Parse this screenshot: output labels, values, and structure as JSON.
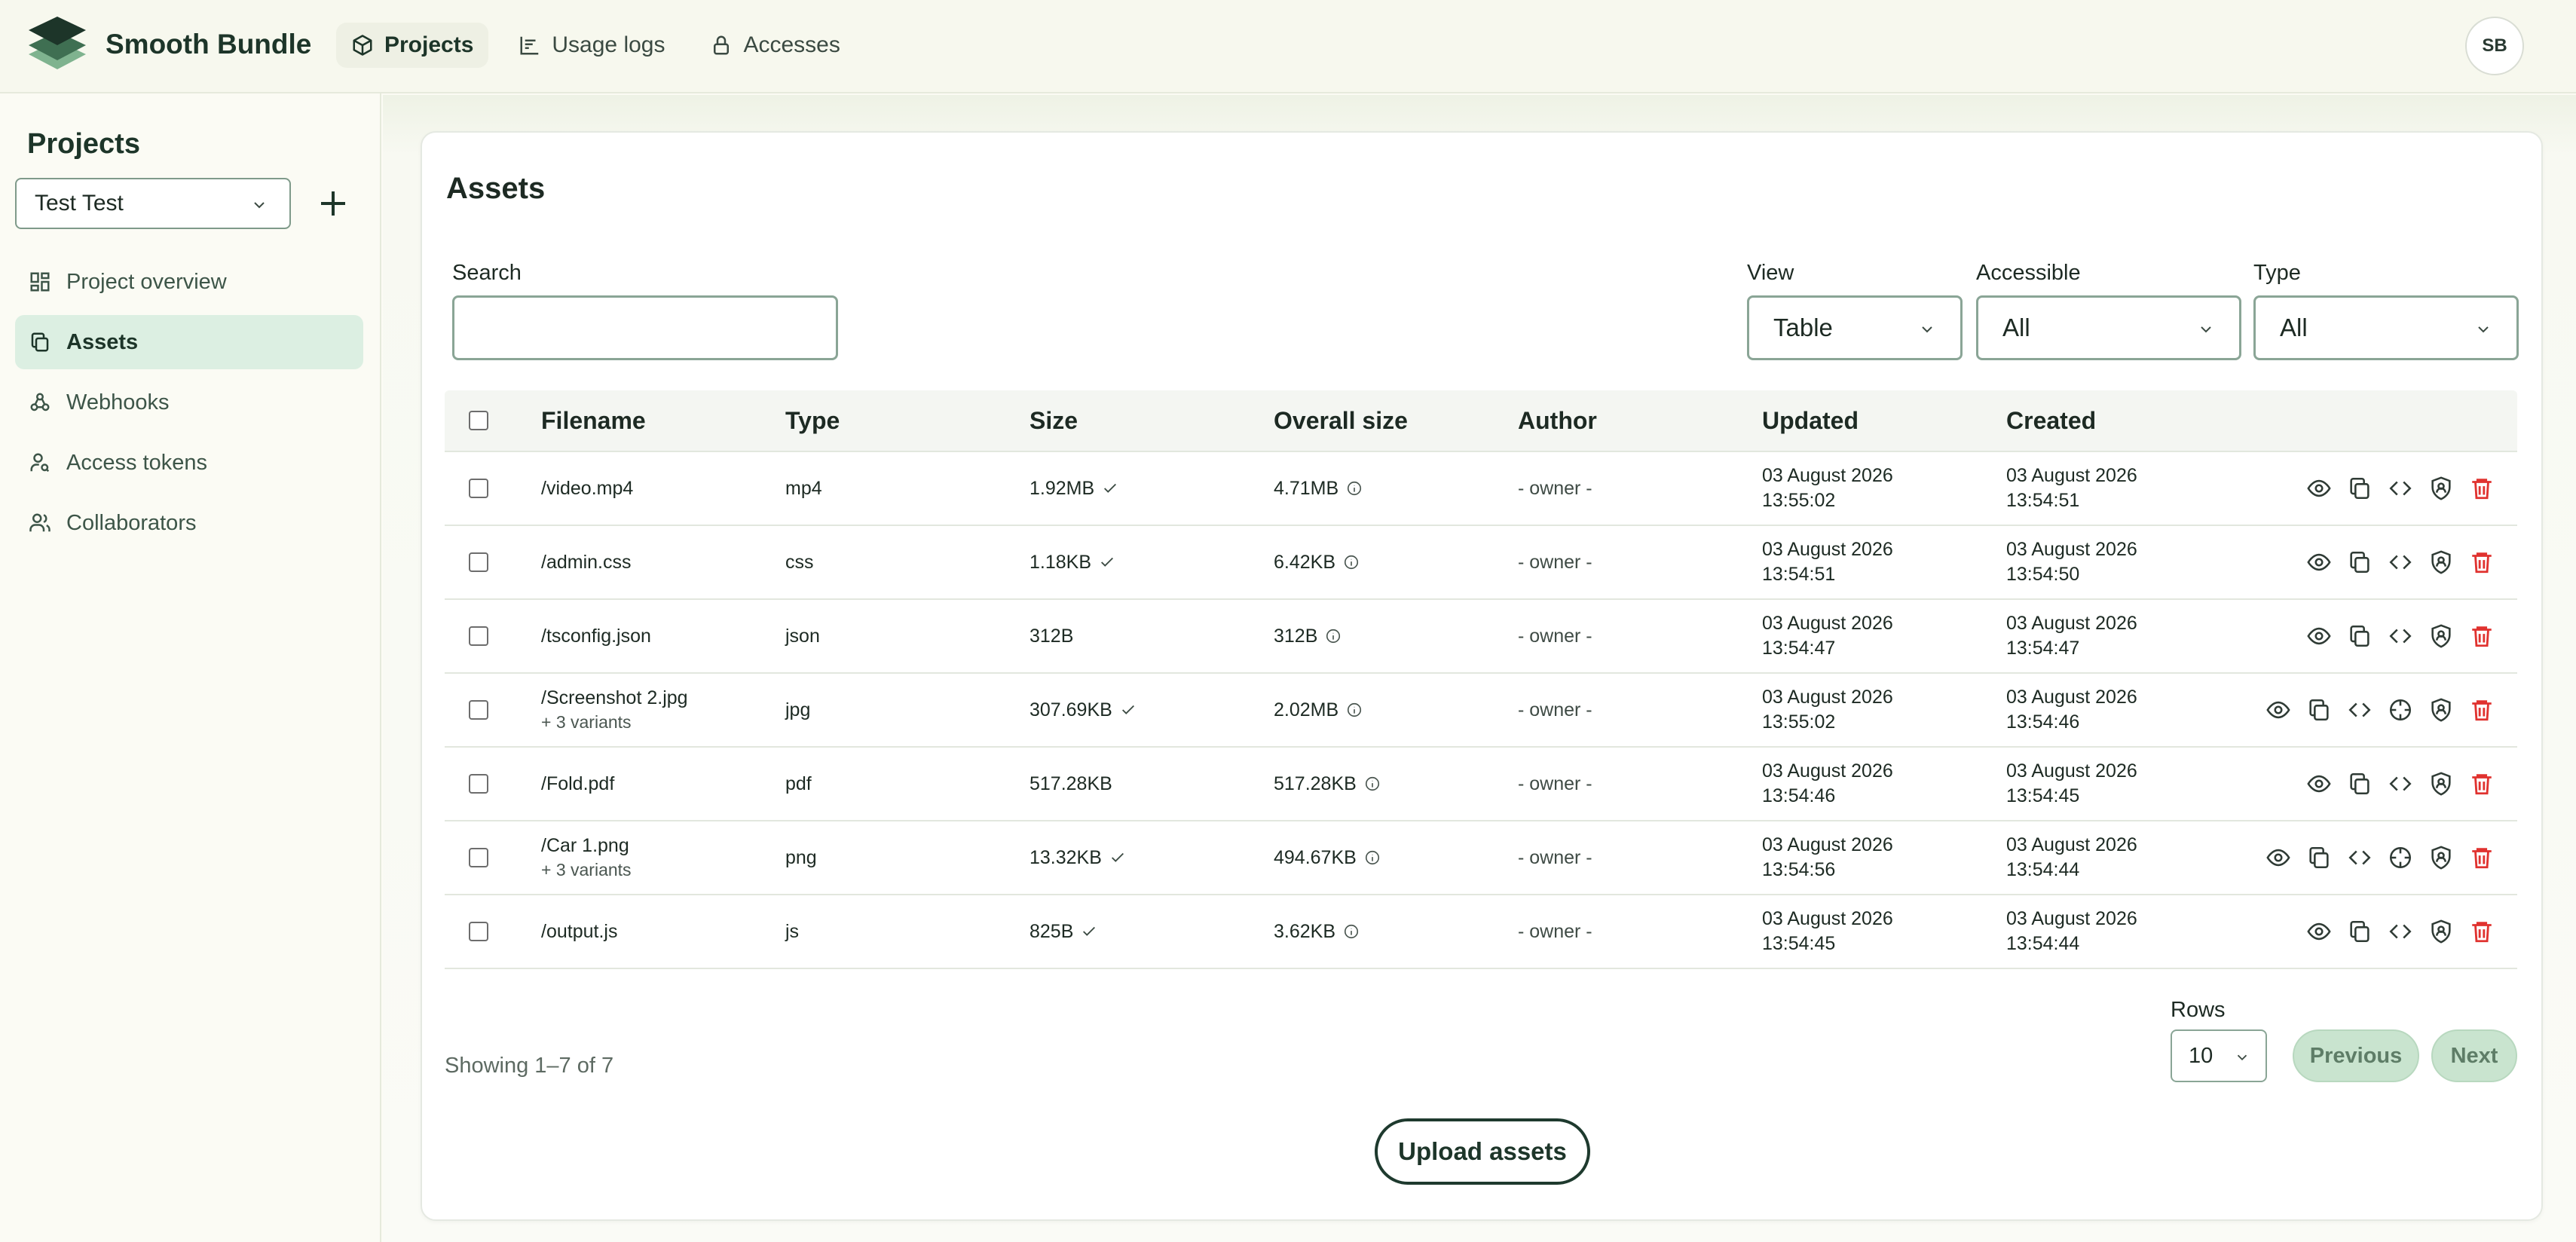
{
  "app": {
    "brand": "Smooth Bundle",
    "avatar_initials": "SB"
  },
  "nav": [
    {
      "label": "Projects",
      "icon": "box-icon",
      "active": true
    },
    {
      "label": "Usage logs",
      "icon": "chart-icon",
      "active": false
    },
    {
      "label": "Accesses",
      "icon": "lock-icon",
      "active": false
    }
  ],
  "sidebar": {
    "title": "Projects",
    "project_selected": "Test Test",
    "items": [
      {
        "label": "Project overview",
        "icon": "grid-icon"
      },
      {
        "label": "Assets",
        "icon": "copy-icon",
        "active": true
      },
      {
        "label": "Webhooks",
        "icon": "webhook-icon"
      },
      {
        "label": "Access tokens",
        "icon": "user-key-icon"
      },
      {
        "label": "Collaborators",
        "icon": "users-icon"
      }
    ]
  },
  "assets": {
    "title": "Assets",
    "filters": {
      "search_label": "Search",
      "search_value": "",
      "view_label": "View",
      "view_value": "Table",
      "accessible_label": "Accessible",
      "accessible_value": "All",
      "type_label": "Type",
      "type_value": "All"
    },
    "columns": [
      "Filename",
      "Type",
      "Size",
      "Overall size",
      "Author",
      "Updated",
      "Created"
    ],
    "rows": [
      {
        "filename": "/video.mp4",
        "variants": "",
        "type": "mp4",
        "size": "1.92MB",
        "size_check": true,
        "overall": "4.71MB",
        "author": "- owner -",
        "updated_date": "03 August 2026",
        "updated_time": "13:55:02",
        "created_date": "03 August 2026",
        "created_time": "13:54:51",
        "has_target": false
      },
      {
        "filename": "/admin.css",
        "variants": "",
        "type": "css",
        "size": "1.18KB",
        "size_check": true,
        "overall": "6.42KB",
        "author": "- owner -",
        "updated_date": "03 August 2026",
        "updated_time": "13:54:51",
        "created_date": "03 August 2026",
        "created_time": "13:54:50",
        "has_target": false
      },
      {
        "filename": "/tsconfig.json",
        "variants": "",
        "type": "json",
        "size": "312B",
        "size_check": false,
        "overall": "312B",
        "author": "- owner -",
        "updated_date": "03 August 2026",
        "updated_time": "13:54:47",
        "created_date": "03 August 2026",
        "created_time": "13:54:47",
        "has_target": false
      },
      {
        "filename": "/Screenshot 2.jpg",
        "variants": "+ 3 variants",
        "type": "jpg",
        "size": "307.69KB",
        "size_check": true,
        "overall": "2.02MB",
        "author": "- owner -",
        "updated_date": "03 August 2026",
        "updated_time": "13:55:02",
        "created_date": "03 August 2026",
        "created_time": "13:54:46",
        "has_target": true
      },
      {
        "filename": "/Fold.pdf",
        "variants": "",
        "type": "pdf",
        "size": "517.28KB",
        "size_check": false,
        "overall": "517.28KB",
        "author": "- owner -",
        "updated_date": "03 August 2026",
        "updated_time": "13:54:46",
        "created_date": "03 August 2026",
        "created_time": "13:54:45",
        "has_target": false
      },
      {
        "filename": "/Car 1.png",
        "variants": "+ 3 variants",
        "type": "png",
        "size": "13.32KB",
        "size_check": true,
        "overall": "494.67KB",
        "author": "- owner -",
        "updated_date": "03 August 2026",
        "updated_time": "13:54:56",
        "created_date": "03 August 2026",
        "created_time": "13:54:44",
        "has_target": true
      },
      {
        "filename": "/output.js",
        "variants": "",
        "type": "js",
        "size": "825B",
        "size_check": true,
        "overall": "3.62KB",
        "author": "- owner -",
        "updated_date": "03 August 2026",
        "updated_time": "13:54:45",
        "created_date": "03 August 2026",
        "created_time": "13:54:44",
        "has_target": false
      }
    ],
    "footer": {
      "showing": "Showing 1–7 of 7",
      "rows_label": "Rows",
      "rows_value": "10",
      "previous": "Previous",
      "next": "Next",
      "upload": "Upload assets"
    }
  },
  "colors": {
    "accent": "#dcefe2",
    "delete": "#e0322f",
    "brand_dark": "#1d3529"
  }
}
